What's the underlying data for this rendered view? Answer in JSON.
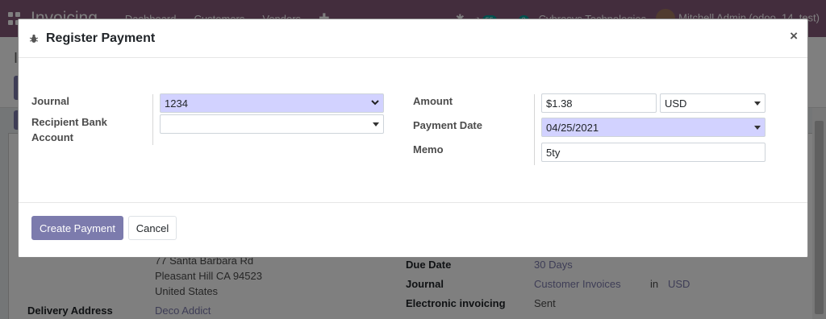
{
  "app": {
    "brand": "Invoicing",
    "menu": [
      "Dashboard",
      "Customers",
      "Vendors"
    ],
    "activity_count": "55",
    "message_count": "8",
    "company": "Cybrosys Technologies",
    "user": "Mitchell Admin (odoo_14_test)",
    "breadcrumb_initial": "I"
  },
  "background_form": {
    "address_line_1": "77 Santa Barbara Rd",
    "address_line_2": "Pleasant Hill CA 94523",
    "address_line_3": "United States",
    "delivery_address_label": "Delivery Address",
    "delivery_address_value": "Deco Addict",
    "due_date_label": "Due Date",
    "due_date_value": "30 Days",
    "journal_label": "Journal",
    "journal_value": "Customer Invoices",
    "journal_in": "in",
    "journal_currency": "USD",
    "einvoicing_label": "Electronic invoicing",
    "einvoicing_value": "Sent"
  },
  "modal": {
    "title": "Register Payment",
    "close_glyph": "×",
    "fields": {
      "journal_label": "Journal",
      "journal_value": "1234",
      "bank_label": "Recipient Bank Account",
      "bank_value": "",
      "amount_label": "Amount",
      "amount_value": "$1.38",
      "currency_value": "USD",
      "date_label": "Payment Date",
      "date_value": "04/25/2021",
      "memo_label": "Memo",
      "memo_value": "5ty"
    },
    "buttons": {
      "create_label": "Create Payment",
      "cancel_label": "Cancel"
    }
  },
  "colors": {
    "primary": "#7c7bad",
    "navbar": "#875a7b",
    "required_field": "#d2d2ff"
  },
  "icons": [
    "apps-menu-icon",
    "plus-icon",
    "bug-icon",
    "chat-icon",
    "activity-icon",
    "close-icon",
    "chevron-down-icon",
    "caret-down-icon"
  ]
}
